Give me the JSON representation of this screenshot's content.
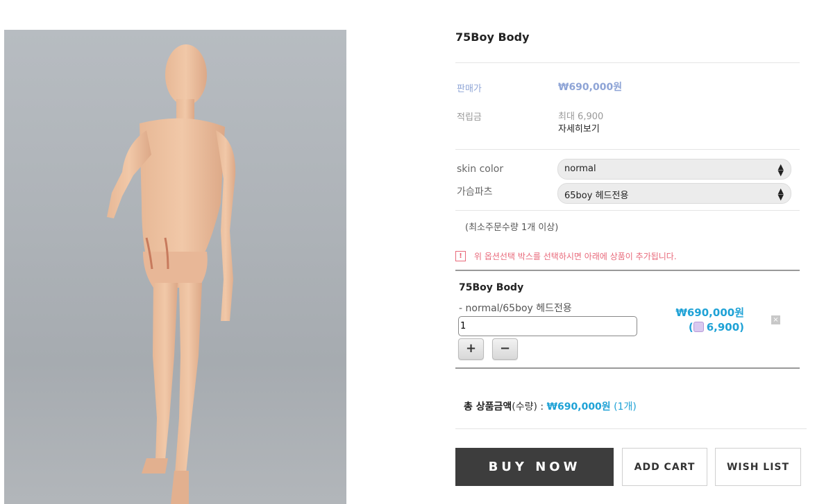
{
  "product": {
    "title": "75Boy Body",
    "price_label": "판매가",
    "price": "₩690,000원",
    "points_label": "적립금",
    "points_max": "최대 6,900",
    "points_detail_link": "자세히보기"
  },
  "options": [
    {
      "label": "skin color",
      "selected": "normal"
    },
    {
      "label": "가슴파츠",
      "selected": "65boy 헤드전용"
    }
  ],
  "min_order_note": "(최소주문수량 1개 이상)",
  "notice": {
    "icon": "!",
    "text": "위 옵션선택 박스를 선택하시면 아래에 상품이 추가됩니다."
  },
  "selected_item": {
    "name": "75Boy Body",
    "option_text": "- normal/65boy 헤드전용",
    "quantity": "1",
    "plus": "+",
    "minus": "−",
    "price": "₩690,000원",
    "points_prefix": "(",
    "points_value": "6,900)",
    "remove_icon": "×"
  },
  "total": {
    "label_bold": "총 상품금액",
    "label_rest": "(수량) : ",
    "amount": "₩690,000원",
    "count": " (1개)"
  },
  "actions": {
    "buy_now": "BUY NOW",
    "add_cart": "ADD CART",
    "wish_list": "WISH LIST"
  },
  "colors": {
    "price_accent": "#8ea4d6",
    "blue_accent": "#1fa2d6",
    "notice_red": "#e8697a",
    "buy_button_bg": "#3d3d3d"
  }
}
